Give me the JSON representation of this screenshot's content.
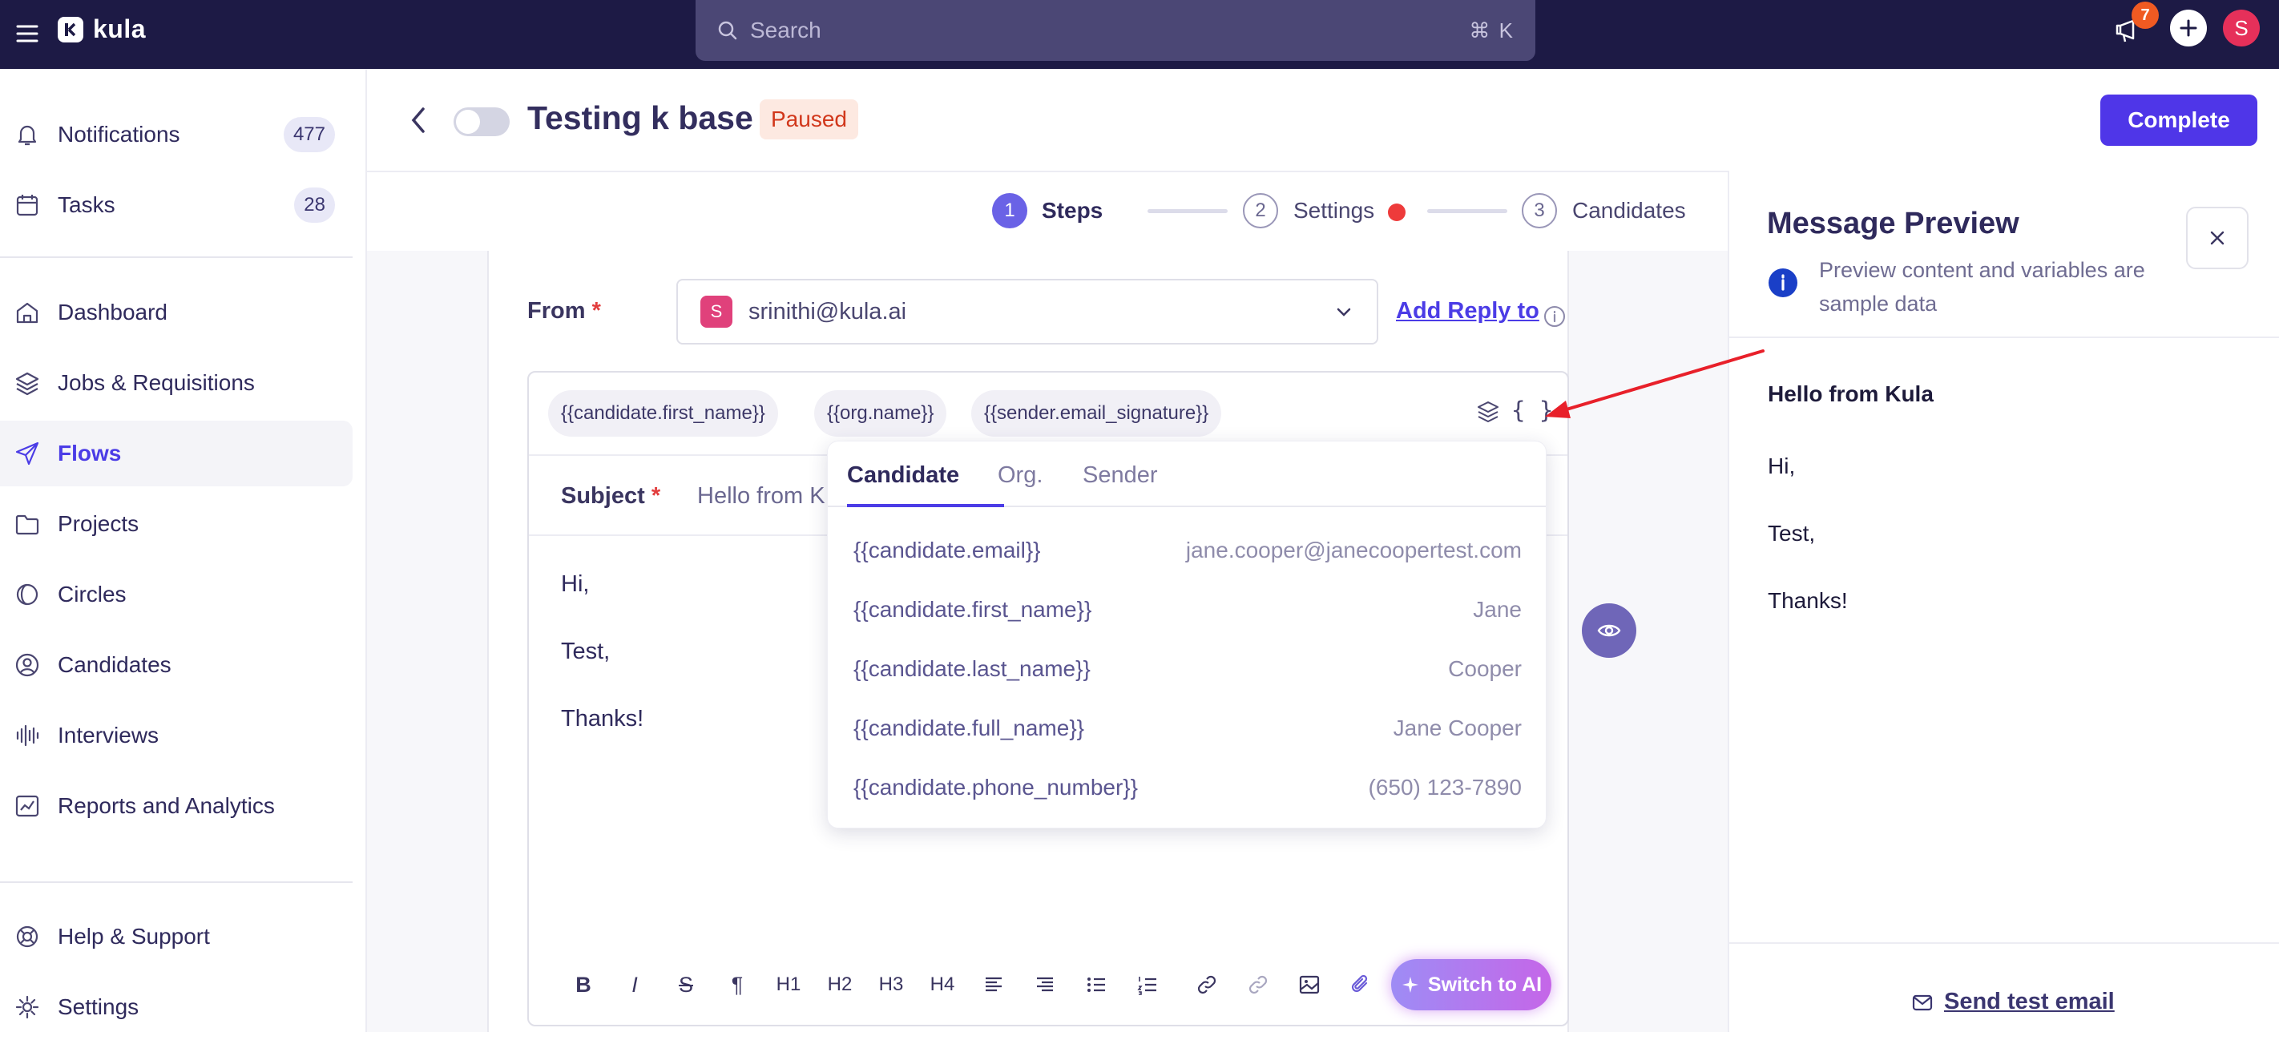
{
  "app": {
    "name": "kula"
  },
  "search": {
    "placeholder": "Search",
    "shortcut": "⌘ K"
  },
  "topbar": {
    "notification_badge": "7",
    "avatar_initial": "S"
  },
  "sidebar": {
    "items": [
      {
        "label": "Notifications",
        "icon": "bell-icon",
        "count": "477"
      },
      {
        "label": "Tasks",
        "icon": "calendar-icon",
        "count": "28"
      },
      {
        "label": "Dashboard",
        "icon": "home-icon"
      },
      {
        "label": "Jobs & Requisitions",
        "icon": "layers-icon"
      },
      {
        "label": "Flows",
        "icon": "send-icon",
        "active": true
      },
      {
        "label": "Projects",
        "icon": "folder-icon"
      },
      {
        "label": "Circles",
        "icon": "circle-half-icon"
      },
      {
        "label": "Candidates",
        "icon": "user-circle-icon"
      },
      {
        "label": "Interviews",
        "icon": "waveform-icon"
      },
      {
        "label": "Reports and Analytics",
        "icon": "chart-icon"
      },
      {
        "label": "Help & Support",
        "icon": "help-icon"
      },
      {
        "label": "Settings",
        "icon": "gear-icon"
      }
    ]
  },
  "header": {
    "title": "Testing k base",
    "status": "Paused",
    "complete_label": "Complete",
    "steps": [
      {
        "num": "1",
        "label": "Steps"
      },
      {
        "num": "2",
        "label": "Settings"
      },
      {
        "num": "3",
        "label": "Candidates"
      }
    ]
  },
  "email": {
    "from_label": "From",
    "from_initial": "S",
    "from_value": "srinithi@kula.ai",
    "add_reply_to": "Add Reply to",
    "variable_chips": [
      "{{candidate.first_name}}",
      "{{org.name}}",
      "{{sender.email_signature}}"
    ],
    "variables_button": "{ }",
    "subject_label": "Subject",
    "subject_value": "Hello from K",
    "body": [
      "Hi,",
      "Test,",
      "Thanks!"
    ],
    "toolbar": [
      "B",
      "I",
      "S",
      "¶",
      "H1",
      "H2",
      "H3",
      "H4"
    ],
    "switch_ai_label": "Switch to AI"
  },
  "variables_dropdown": {
    "tabs": [
      "Candidate",
      "Org.",
      "Sender"
    ],
    "rows": [
      {
        "key": "{{candidate.email}}",
        "value": "jane.cooper@janecoopertest.com"
      },
      {
        "key": "{{candidate.first_name}}",
        "value": "Jane"
      },
      {
        "key": "{{candidate.last_name}}",
        "value": "Cooper"
      },
      {
        "key": "{{candidate.full_name}}",
        "value": "Jane Cooper"
      },
      {
        "key": "{{candidate.phone_number}}",
        "value": "(650) 123-7890"
      }
    ]
  },
  "preview": {
    "title": "Message Preview",
    "note": "Preview content and variables are sample data",
    "subject": "Hello from Kula",
    "lines": [
      "Hi,",
      "Test,",
      "Thanks!"
    ],
    "send_test": "Send test email"
  },
  "colors": {
    "accent": "#4f36e8",
    "topbar": "#1d1a45",
    "paused": "#d1371b",
    "annotation_arrow": "#e8202a"
  }
}
